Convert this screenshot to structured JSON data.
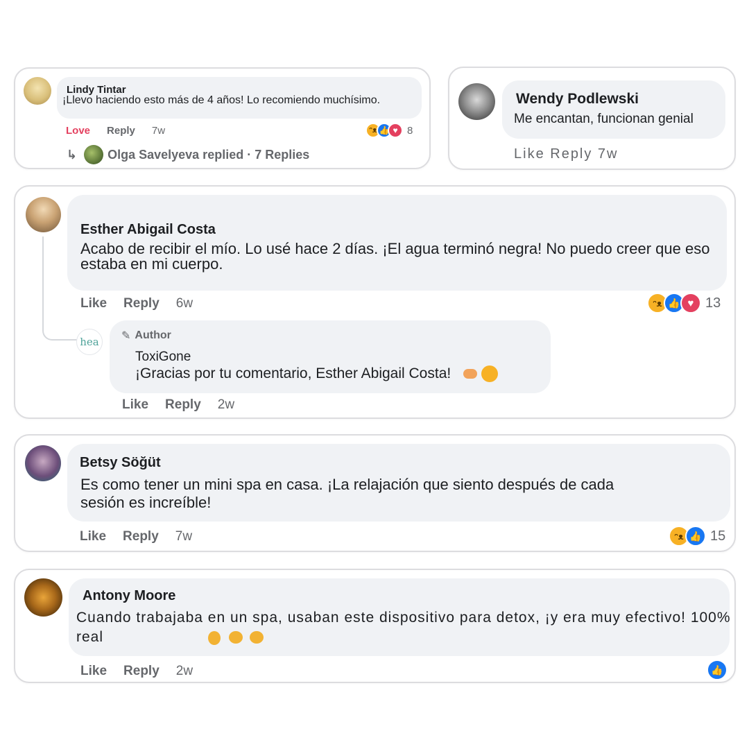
{
  "comments": [
    {
      "name": "Lindy Tintar",
      "text": "¡Llevo haciendo esto más de 4 años! Lo recomiendo muchísimo.",
      "actions": {
        "first": "Love",
        "reply": "Reply",
        "time": "7w"
      },
      "reaction_count": "8",
      "replies_text": "Olga Savelyeva replied · 7 Replies"
    },
    {
      "name": "Wendy Podlewski",
      "text": "Me encantan, funcionan genial",
      "actions_text": "Like Reply 7w"
    },
    {
      "name": "Esther Abigail Costa",
      "text": "Acabo de recibir el mío. Lo usé hace 2 días. ¡El agua terminó negra! No puedo creer que eso estaba en mi cuerpo.",
      "actions": {
        "like": "Like",
        "reply": "Reply",
        "time": "6w"
      },
      "reaction_count": "13",
      "reply": {
        "badge": "Author",
        "author": "ToxiGone",
        "avatar_text": "hea",
        "text": "¡Gracias por tu comentario, Esther Abigail Costa!",
        "actions": {
          "like": "Like",
          "reply": "Reply",
          "time": "2w"
        }
      }
    },
    {
      "name": "Betsy Söğüt",
      "text": "Es como tener un mini spa en casa. ¡La relajación que siento después de cada sesión es increíble!",
      "actions": {
        "like": "Like",
        "reply": "Reply",
        "time": "7w"
      },
      "reaction_count": "15"
    },
    {
      "name": "Antony Moore",
      "text": "Cuando trabajaba en un spa, usaban este dispositivo para detox, ¡y era muy efectivo! 100% real",
      "actions": {
        "like": "Like",
        "reply": "Reply",
        "time": "2w"
      }
    }
  ],
  "colors": {
    "like": "#1877f2",
    "love": "#e4405f",
    "haha": "#f7b125",
    "muted": "#65676b",
    "bubble": "#f0f2f5"
  }
}
